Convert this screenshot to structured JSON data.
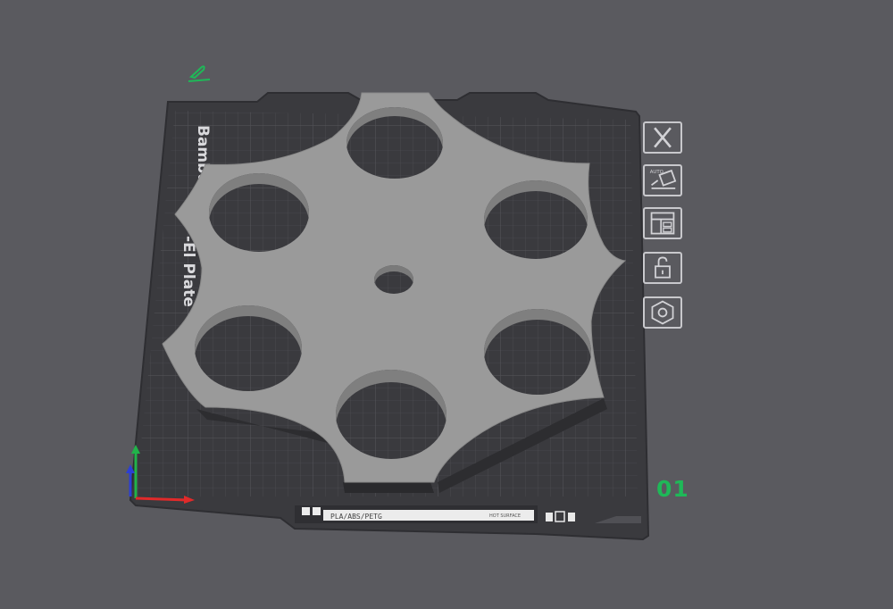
{
  "plate": {
    "brand_text": "Bambu",
    "plate_text": "-El Plate",
    "material_label": "PLA/ABS/PETG",
    "surface_label": "HOT SURFACE",
    "number": "01"
  },
  "toolbar": {
    "close": "close-icon",
    "auto_orient": "auto-orient-icon",
    "auto_orient_badge": "AUTO",
    "arrange": "arrange-icon",
    "lock": "unlock-icon",
    "settings": "plate-settings-icon"
  },
  "colors": {
    "background": "#5a5a5f",
    "plate": "#3a3a3e",
    "model": "#9a9a9a",
    "plate_number": "#1fb858",
    "axis_x": "#e02a2a",
    "axis_y": "#21b34a",
    "axis_z": "#2b3fd6"
  }
}
